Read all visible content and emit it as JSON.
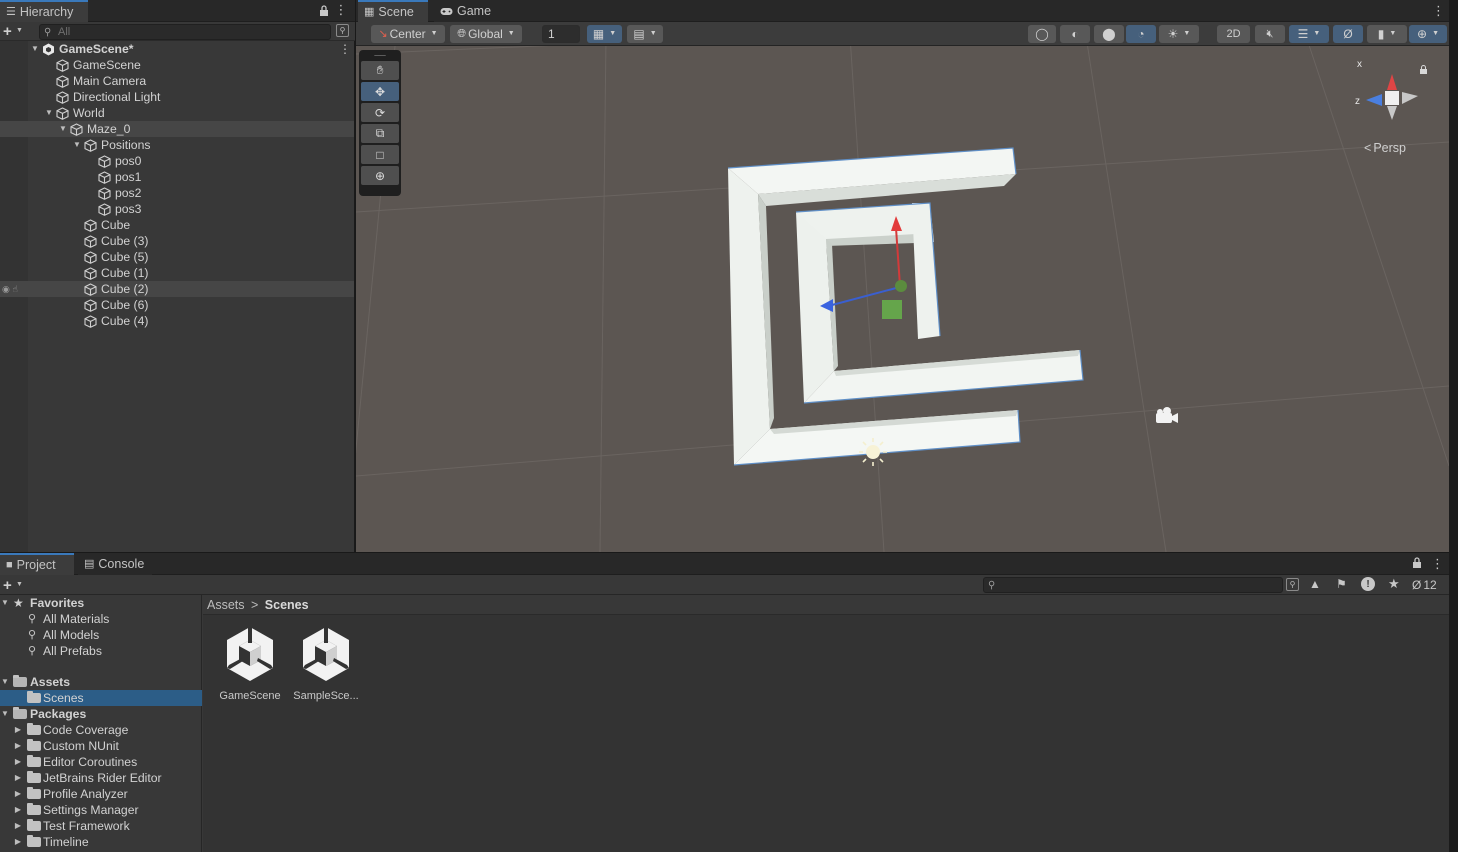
{
  "hierarchy": {
    "tab_label": "Hierarchy",
    "search_placeholder": "All",
    "rows": [
      {
        "label": "GameScene*",
        "depth": 0,
        "arrow": "down",
        "bold": true,
        "icon": "unity-scene-icon"
      },
      {
        "label": "GameScene",
        "depth": 1,
        "arrow": "",
        "icon": "cube-icon"
      },
      {
        "label": "Main Camera",
        "depth": 1,
        "arrow": "",
        "icon": "cube-icon"
      },
      {
        "label": "Directional Light",
        "depth": 1,
        "arrow": "",
        "icon": "cube-icon"
      },
      {
        "label": "World",
        "depth": 1,
        "arrow": "down",
        "icon": "cube-icon"
      },
      {
        "label": "Maze_0",
        "depth": 2,
        "arrow": "down",
        "icon": "cube-icon",
        "highlight": true
      },
      {
        "label": "Positions",
        "depth": 3,
        "arrow": "down",
        "icon": "cube-icon"
      },
      {
        "label": "pos0",
        "depth": 4,
        "arrow": "",
        "icon": "cube-icon"
      },
      {
        "label": "pos1",
        "depth": 4,
        "arrow": "",
        "icon": "cube-icon"
      },
      {
        "label": "pos2",
        "depth": 4,
        "arrow": "",
        "icon": "cube-icon"
      },
      {
        "label": "pos3",
        "depth": 4,
        "arrow": "",
        "icon": "cube-icon"
      },
      {
        "label": "Cube",
        "depth": 3,
        "arrow": "",
        "icon": "cube-icon"
      },
      {
        "label": "Cube (3)",
        "depth": 3,
        "arrow": "",
        "icon": "cube-icon"
      },
      {
        "label": "Cube (5)",
        "depth": 3,
        "arrow": "",
        "icon": "cube-icon"
      },
      {
        "label": "Cube (1)",
        "depth": 3,
        "arrow": "",
        "icon": "cube-icon"
      },
      {
        "label": "Cube (2)",
        "depth": 3,
        "arrow": "",
        "icon": "cube-icon",
        "highlight": true
      },
      {
        "label": "Cube (6)",
        "depth": 3,
        "arrow": "",
        "icon": "cube-icon"
      },
      {
        "label": "Cube (4)",
        "depth": 3,
        "arrow": "",
        "icon": "cube-icon"
      }
    ]
  },
  "scene": {
    "tabs": [
      {
        "label": "Scene",
        "icon": "grid-icon",
        "active": true
      },
      {
        "label": "Game",
        "icon": "gamepad-icon",
        "active": false
      }
    ],
    "pivot_mode": "Center",
    "pivot_rotation": "Global",
    "grid_snap_value": "1",
    "view_2d_label": "2D",
    "projection_label": "Persp",
    "gizmo_axes": {
      "x": "x",
      "z": "z"
    }
  },
  "project": {
    "tabs": [
      {
        "label": "Project",
        "icon": "folder-icon",
        "active": true
      },
      {
        "label": "Console",
        "icon": "console-icon",
        "active": false
      }
    ],
    "hidden_count": "12",
    "favorites_label": "Favorites",
    "favorites": [
      "All Materials",
      "All Models",
      "All Prefabs"
    ],
    "assets_label": "Assets",
    "assets_children": [
      "Scenes"
    ],
    "packages_label": "Packages",
    "packages": [
      "Code Coverage",
      "Custom NUnit",
      "Editor Coroutines",
      "JetBrains Rider Editor",
      "Profile Analyzer",
      "Settings Manager",
      "Test Framework",
      "Timeline"
    ],
    "breadcrumb": {
      "root": "Assets",
      "separator": ">",
      "current": "Scenes"
    },
    "files": [
      {
        "label": "GameScene",
        "icon": "unity-scene-icon"
      },
      {
        "label": "SampleSce...",
        "icon": "unity-scene-icon"
      }
    ]
  },
  "colors": {
    "selection_blue": "#2c5d87",
    "active_tab_accent": "#3a79bb",
    "viewport_ground": "#5c5652",
    "maze_wall": "#eef3ef"
  }
}
